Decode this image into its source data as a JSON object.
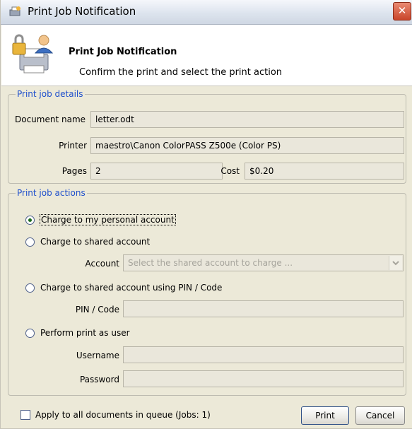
{
  "window": {
    "title": "Print Job Notification",
    "close_glyph": "✕"
  },
  "header": {
    "title": "Print Job Notification",
    "subtitle": "Confirm the print and select the print action",
    "icon": "printer-lock-user-icon"
  },
  "details": {
    "group_title": "Print job details",
    "document_label": "Document name",
    "document_value": "letter.odt",
    "printer_label": "Printer",
    "printer_value": "maestro\\Canon ColorPASS Z500e (Color PS)",
    "pages_label": "Pages",
    "pages_value": "2",
    "cost_label": "Cost",
    "cost_value": "$0.20"
  },
  "actions": {
    "group_title": "Print job actions",
    "options": [
      {
        "label": "Charge to my personal account",
        "selected": true
      },
      {
        "label": "Charge to shared account",
        "selected": false
      },
      {
        "label": "Charge to shared account using PIN / Code",
        "selected": false
      },
      {
        "label": "Perform print as user",
        "selected": false
      }
    ],
    "account_label": "Account",
    "account_placeholder": "Select the shared account to charge ...",
    "pin_label": "PIN / Code",
    "username_label": "Username",
    "password_label": "Password"
  },
  "footer": {
    "apply_all_label": "Apply to all documents in queue (Jobs: 1)",
    "apply_all_checked": false,
    "print_label": "Print",
    "cancel_label": "Cancel"
  },
  "colors": {
    "group_title": "#1e4fcc",
    "dialog_background": "#ece9d8",
    "selected_radio_dot": "#1c6b1c"
  }
}
